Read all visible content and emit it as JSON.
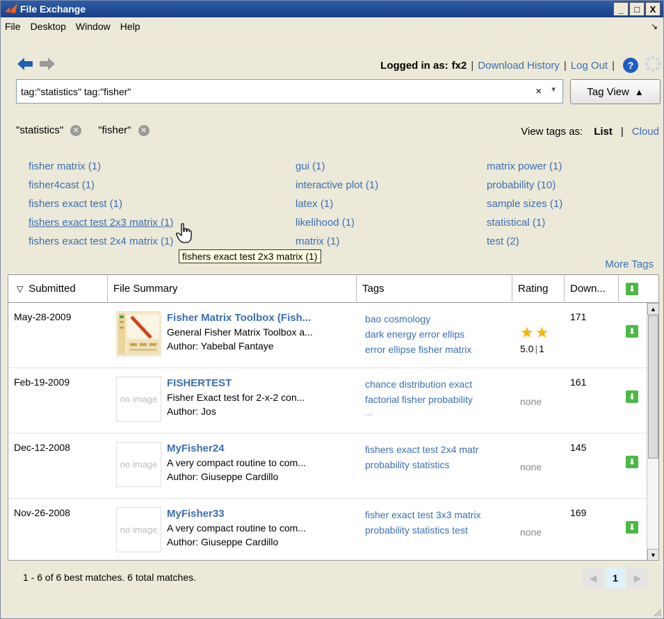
{
  "window": {
    "title": "File Exchange",
    "controls": [
      "_",
      "□",
      "X"
    ]
  },
  "menu": [
    "File",
    "Desktop",
    "Window",
    "Help"
  ],
  "nav": {
    "logged_in_label": "Logged in as:",
    "username": "fx2",
    "download_history": "Download History",
    "log_out": "Log Out",
    "help": "?"
  },
  "search": {
    "value": "tag:\"statistics\" tag:\"fisher\"",
    "clear": "×",
    "dropdown": "▼",
    "tag_view_label": "Tag View"
  },
  "filters": {
    "chips": [
      "\"statistics\"",
      "\"fisher\""
    ],
    "view_tags_as": "View tags as:",
    "list": "List",
    "separator": "|",
    "cloud": "Cloud"
  },
  "tags": {
    "col1": [
      "fisher matrix (1)",
      "fisher4cast (1)",
      "fishers exact test (1)",
      "fishers exact test 2x3 matrix (1)",
      "fishers exact test 2x4 matrix (1)"
    ],
    "col2": [
      "gui (1)",
      "interactive plot (1)",
      "latex (1)",
      "likelihood (1)",
      "matrix (1)"
    ],
    "col3": [
      "matrix power (1)",
      "probability (10)",
      "sample sizes (1)",
      "statistical (1)",
      "test (2)"
    ],
    "tooltip": "fishers exact test 2x3 matrix (1)",
    "more_tags": "More Tags"
  },
  "table": {
    "headers": {
      "submitted": "Submitted",
      "summary": "File Summary",
      "tags": "Tags",
      "rating": "Rating",
      "downloads": "Down..."
    },
    "rows": [
      {
        "date": "May-28-2009",
        "title": "Fisher Matrix Toolbox (Fish...",
        "desc": "General Fisher Matrix Toolbox a...",
        "author": "Author: Yabebal Fantaye",
        "tags": [
          "bao cosmology",
          "dark energy error ellips",
          "error ellipse fisher matrix"
        ],
        "stars": "★★",
        "score": "5.0",
        "count": "1",
        "downloads": "171"
      },
      {
        "date": "Feb-19-2009",
        "thumb": "no image",
        "title": "FISHERTEST",
        "desc": "Fisher Exact test for 2-x-2 con...",
        "author": "Author: Jos",
        "tags": [
          "chance distribution exact",
          "factorial fisher probability",
          "..."
        ],
        "rating": "none",
        "downloads": "161"
      },
      {
        "date": "Dec-12-2008",
        "thumb": "no image",
        "title": "MyFisher24",
        "desc": "A very compact routine to com...",
        "author": "Author: Giuseppe Cardillo",
        "tags": [
          "fishers exact test 2x4 matr",
          "probability statistics"
        ],
        "rating": "none",
        "downloads": "145"
      },
      {
        "date": "Nov-26-2008",
        "thumb": "no image",
        "title": "MyFisher33",
        "desc": "A very compact routine to com...",
        "author": "Author: Giuseppe Cardillo",
        "tags": [
          "fisher exact test 3x3 matrix",
          "probability statistics test"
        ],
        "rating": "none",
        "downloads": "169"
      }
    ]
  },
  "status": "1 - 6 of 6 best matches. 6 total matches.",
  "pager": {
    "prev": "◀",
    "current": "1",
    "next": "▶"
  },
  "colors": {
    "link": "#3a6fb4",
    "titlebar": "#2c5ea8",
    "download": "#4cb848",
    "star": "#f5b400"
  }
}
